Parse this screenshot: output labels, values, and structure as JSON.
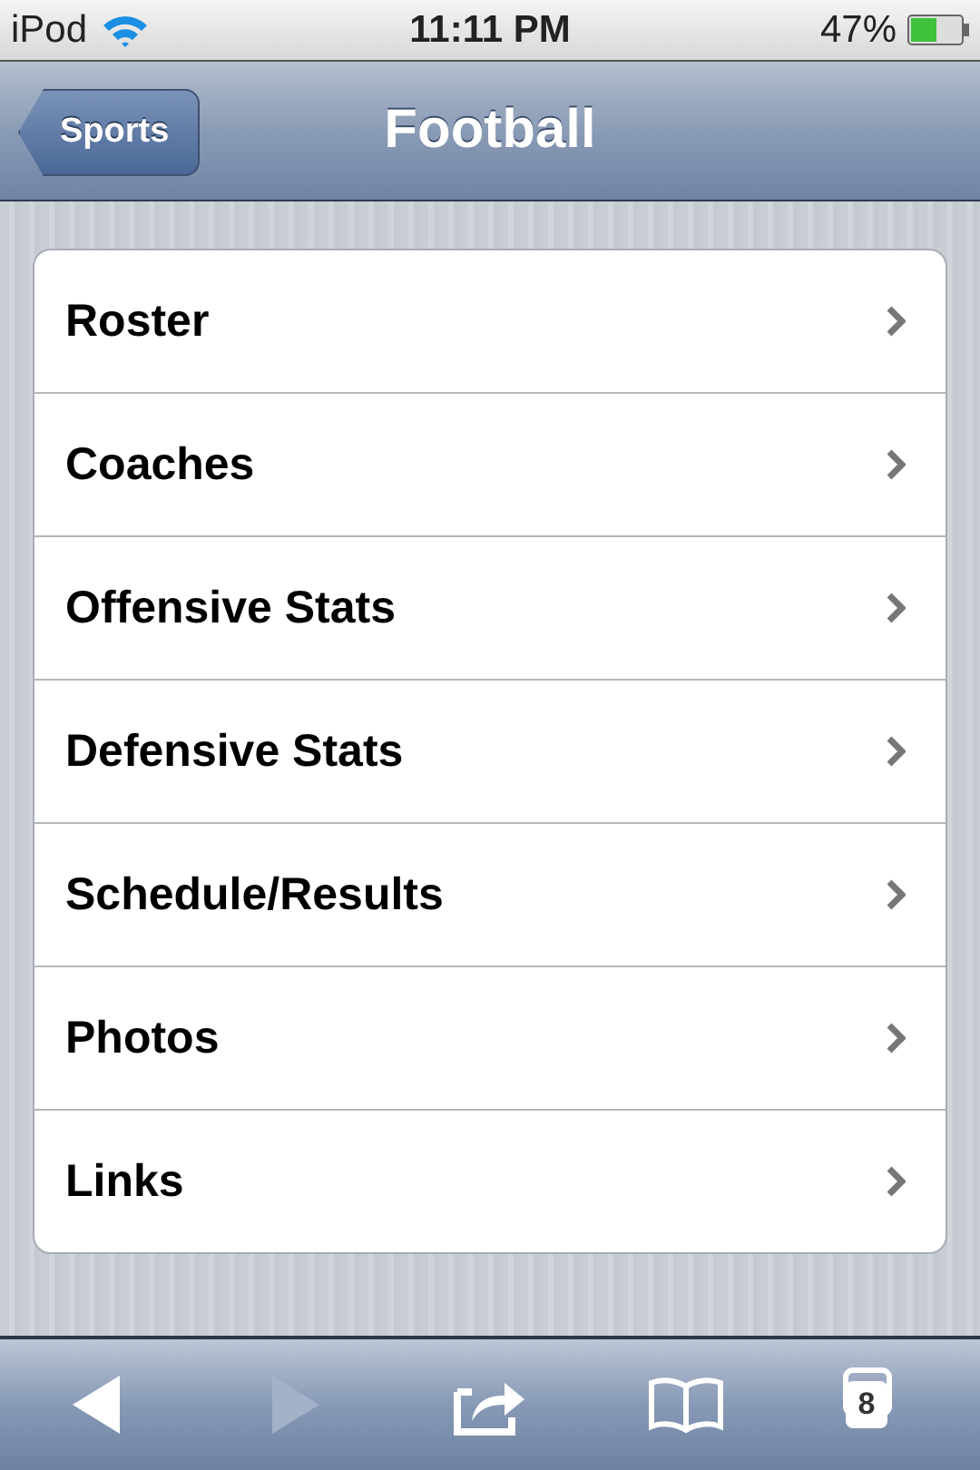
{
  "status_bar": {
    "carrier": "iPod",
    "time": "11:11 PM",
    "battery": "47%"
  },
  "nav_bar": {
    "back_button": "Sports",
    "title": "Football"
  },
  "items": [
    {
      "label": "Roster"
    },
    {
      "label": "Coaches"
    },
    {
      "label": "Offensive Stats"
    },
    {
      "label": "Defensive Stats"
    },
    {
      "label": "Schedule/Results"
    },
    {
      "label": "Photos"
    },
    {
      "label": "Links"
    }
  ],
  "toolbar": {
    "buttons": [
      {
        "kind": "back",
        "disabled": false
      },
      {
        "kind": "forward",
        "disabled": true
      },
      {
        "kind": "share",
        "disabled": false
      },
      {
        "kind": "bookmarks",
        "disabled": false
      },
      {
        "kind": "pages",
        "disabled": false,
        "count": "8"
      }
    ]
  }
}
